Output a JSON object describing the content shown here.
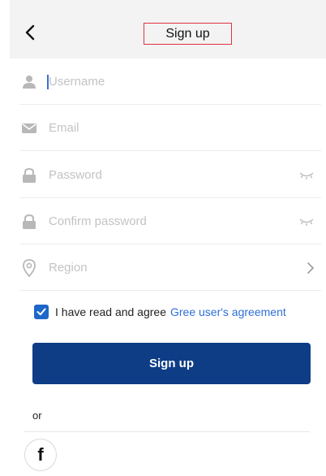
{
  "header": {
    "title": "Sign up"
  },
  "form": {
    "username_placeholder": "Username",
    "email_placeholder": "Email",
    "password_placeholder": "Password",
    "confirm_placeholder": "Confirm password",
    "region_placeholder": "Region"
  },
  "agreement": {
    "text": "I have read and agree",
    "link": "Gree user's agreement",
    "checked": true
  },
  "actions": {
    "signup_label": "Sign up",
    "or_label": "or"
  },
  "social": {
    "facebook_glyph": "f"
  },
  "colors": {
    "primary": "#0e3d86",
    "link": "#2f6fd6",
    "checkbox": "#1e66c8",
    "highlight_border": "#e0333f"
  }
}
